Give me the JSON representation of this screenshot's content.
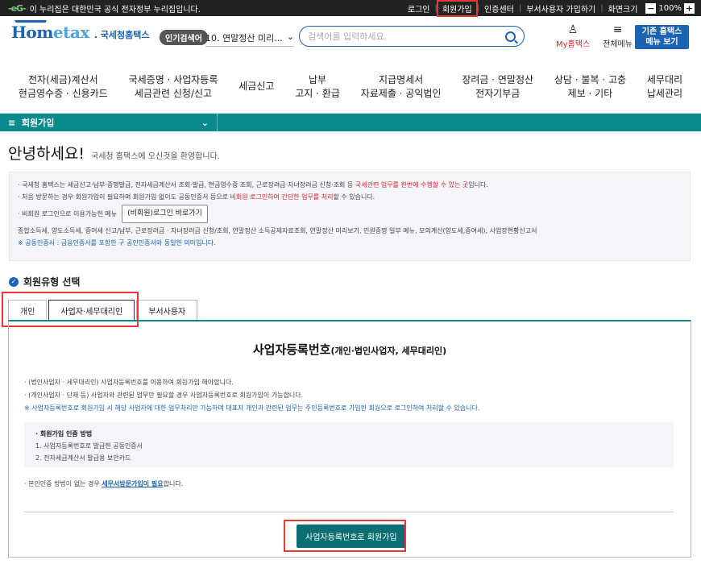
{
  "topbar": {
    "gov_notice": "이 누리집은 대한민국 공식 전자정부 누리집입니다.",
    "links": [
      "로그인",
      "회원가입",
      "인증센터",
      "부서사용자 가입하기",
      "화면크기"
    ],
    "zoom_level": "100%",
    "zoom_minus": "−",
    "zoom_plus": "+"
  },
  "header": {
    "logo_home": "Hom",
    "logo_tax": "etax",
    "logo_nts": ". 국세청홈택스",
    "popular_badge": "인기검색어",
    "popular_item": "10. 연말정산 미리...",
    "popular_num": "10.",
    "search_placeholder": "검색어를 입력하세요.",
    "my_hometax": "My홈택스",
    "all_menu": "전체메뉴",
    "old_hometax_line1": "기존 홈택스",
    "old_hometax_line2": "메뉴 보기"
  },
  "gnb": [
    {
      "l1": "전자(세금)계산서",
      "l2": "현금영수증 · 신용카드"
    },
    {
      "l1": "국세증명 · 사업자등록",
      "l2": "세금관련 신청/신고"
    },
    {
      "l1": "세금신고",
      "l2": ""
    },
    {
      "l1": "납부",
      "l2": "고지 · 환급"
    },
    {
      "l1": "지급명세서",
      "l2": "자료제출 · 공익법인"
    },
    {
      "l1": "장려금 · 연말정산",
      "l2": "전자기부금"
    },
    {
      "l1": "상담 · 불복 · 고충",
      "l2": "제보 · 기타"
    },
    {
      "l1": "세무대리",
      "l2": "납세관리"
    }
  ],
  "breadcrumb": {
    "menu_icon": "≡",
    "label": "회원가입",
    "chevron": "⌄"
  },
  "greeting": {
    "title": "안녕하세요!",
    "subtitle": "국세청 홈택스에 오신것을 환영합니다."
  },
  "notice": {
    "line1_a": "· 국세청 홈택스는 세금신고·납부·증명발급, 전자세금계산서 조회·발급, 현금영수증 조회, 근로장려금·자녀장려금 신청·조회 등 ",
    "line1_b": "국세관련 업무를 한번에 수행할 수 있는 곳",
    "line1_c": "입니다.",
    "line2_a": "· 처음 방문하는 경우 회원가입이 필요하며 회원가입 없이도 공동인증서 등으로 ",
    "line2_b": "비회원 로그인하여 간단한 업무를 처리",
    "line2_c": "할 수 있습니다.",
    "line3": "· 비회원 로그인으로 이용가능한 메뉴",
    "nonmember_button": "(비회원)로그인 바로가기",
    "line4": "종합소득세, 양도소득세, 증여세 신고/납부, 근로장려금 · 자녀장려금 신청/조회, 연말정산 소득공제자료조회, 연말정산 미리보기, 민원증명 일부 메뉴, 모의계산(양도세,증여세), 사업장현황신고서",
    "line5": "※ 공동인증서 : 금융인증서를 포함한 구 공인인증서와 동일한 의미입니다."
  },
  "member_type": {
    "check": "✓",
    "title": "회원유형 선택"
  },
  "tabs": [
    "개인",
    "사업자·세무대리인",
    "부서사용자"
  ],
  "panel": {
    "title": "사업자등록번호",
    "title_sub": "(개인·법인사업자, 세무대리인)",
    "line1": "· (법인사업자 · 세무대리인) 사업자등록번호를 이용하여 회원가입 해야합니다.",
    "line2": "· (개인사업자 · 단체 등) 사업자와 관련된 업무만 필요할 경우 사업자등록번호로 회원가입이 가능합니다.",
    "line3": "※ 사업자등록번호로 회원가입 시 해당 사업자에 대한 업무처리만 가능하며 대표자 개인과 관련된 업무는 주민등록번호로 가입한 회원으로 로그인하여 처리할 수 있습니다.",
    "auth_title": "· 회원가입 인증 방법",
    "auth_1": "1. 사업자등록번호로 발급한 공동인증서",
    "auth_2": "2. 전자세금계산서 발급용 보안카드",
    "nomethod_a": "· 본인인증 방법이 없는 경우 ",
    "nomethod_link": "세무서방문가입이 필요",
    "nomethod_c": "합니다.",
    "join_button": "사업자등록번호로 회원가입"
  }
}
